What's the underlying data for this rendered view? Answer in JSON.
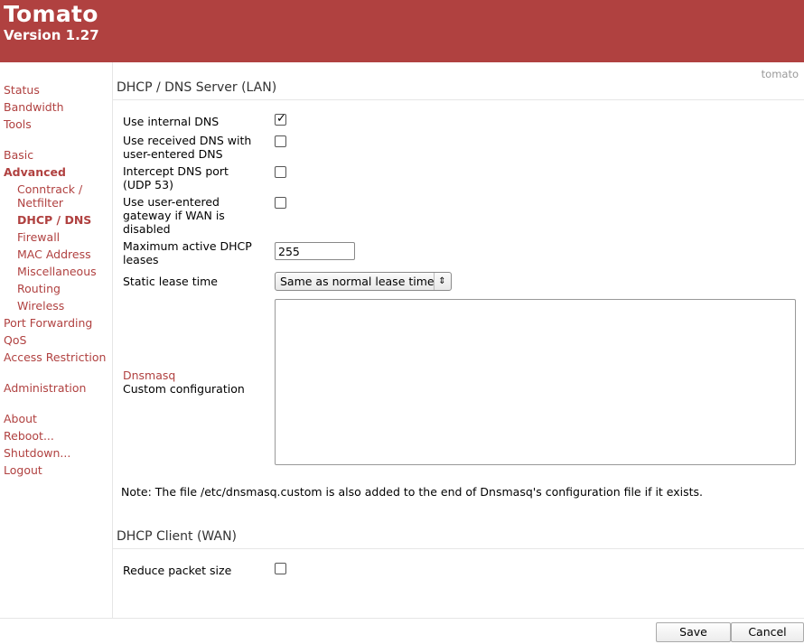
{
  "header": {
    "title": "Tomato",
    "version": "Version 1.27"
  },
  "hostname": "tomato",
  "sidebar": {
    "group1": [
      "Status",
      "Bandwidth",
      "Tools"
    ],
    "group2": [
      "Basic",
      "Advanced"
    ],
    "advanced_sub": [
      "Conntrack /",
      "Netfilter",
      "DHCP / DNS",
      "Firewall",
      "MAC Address",
      "Miscellaneous",
      "Routing",
      "Wireless"
    ],
    "group2b": [
      "Port Forwarding",
      "QoS",
      "Access Restriction"
    ],
    "group3": [
      "Administration"
    ],
    "group4": [
      "About",
      "Reboot...",
      "Shutdown...",
      "Logout"
    ],
    "active_item": "DHCP / DNS"
  },
  "lan": {
    "title": "DHCP / DNS Server (LAN)",
    "use_internal_dns": {
      "label": "Use internal DNS",
      "checked": true
    },
    "use_received_dns": {
      "label_line1": "Use received DNS with",
      "label_line2": "user-entered DNS",
      "checked": false
    },
    "intercept_dns": {
      "label_line1": "Intercept DNS port",
      "label_line2": "(UDP 53)",
      "checked": false
    },
    "use_user_gateway": {
      "label_line1": "Use user-entered",
      "label_line2": "gateway if WAN is",
      "label_line3": "disabled",
      "checked": false
    },
    "max_leases": {
      "label_line1": "Maximum active DHCP",
      "label_line2": "leases",
      "value": "255"
    },
    "static_lease": {
      "label": "Static lease time",
      "selected": "Same as normal lease time"
    },
    "custom": {
      "link": "Dnsmasq",
      "label": "Custom configuration",
      "value": ""
    },
    "note": "Note: The file /etc/dnsmasq.custom is also added to the end of Dnsmasq's configuration file if it exists."
  },
  "wan": {
    "title": "DHCP Client (WAN)",
    "reduce_packet": {
      "label": "Reduce packet size",
      "checked": false
    }
  },
  "buttons": {
    "save": "Save",
    "cancel": "Cancel"
  },
  "colors": {
    "accent": "#b04140"
  }
}
